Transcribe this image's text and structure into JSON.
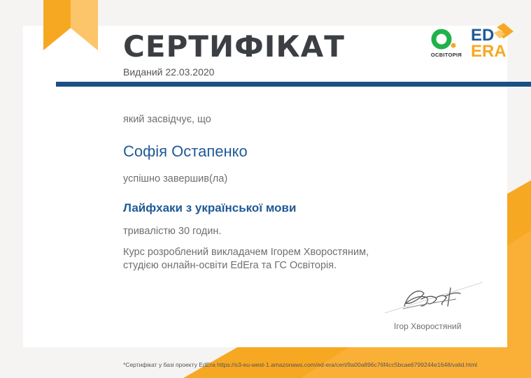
{
  "certificate": {
    "title": "СЕРТИФІКАТ",
    "issued": "Виданий 22.03.2020",
    "certifies_label": "який засвідчує, що",
    "recipient_name": "Софія Остапенко",
    "completed_label": "успішно завершив(ла)",
    "course_title": "Лайфхаки з української мови",
    "duration": "тривалістю 30 годин.",
    "description_line1": "Курс розроблений викладачем Ігорем Хворостяним,",
    "description_line2": "студією онлайн-освіти EdEra та ГС Освіторія.",
    "signer_name": "Ігор Хворостяний",
    "footnote": "*Сертифікат у базі проекту EdEra https://s3-eu-west-1.amazonaws.com/ed-era/cert/9a00a896c76f4cc5bcae6799244e1648/valid.html"
  },
  "logos": {
    "osvitoria_text": "ОСВІТОРІЯ",
    "edera_line1": "ED",
    "edera_line2": "ERA"
  },
  "colors": {
    "accent_orange": "#f7a823",
    "accent_light_orange": "#fcc56a",
    "navy_rule": "#1b4f86",
    "text_blue": "#1f5a96",
    "title_gray": "#3b3e43",
    "osvitoria_green": "#1fb24a"
  },
  "icons": [
    "bookmark-ribbon-icon",
    "osvitoria-logo-icon",
    "edera-logo-icon",
    "signature-icon"
  ]
}
